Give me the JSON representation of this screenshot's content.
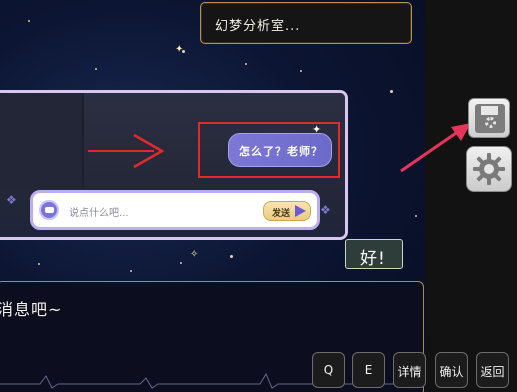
{
  "top_message": {
    "text": "幻梦分析室..."
  },
  "phone": {
    "chat_bubble_text": "怎么了？老师？",
    "input_placeholder": "说点什么吧...",
    "send_label": "发送"
  },
  "reply_bubble": {
    "text": "好!"
  },
  "dialogue": {
    "text": "消息吧~"
  },
  "side_buttons": {
    "save_icon": "floppy-disk-icon",
    "settings_icon": "gear-icon"
  },
  "bottom_buttons": [
    {
      "label": "Q"
    },
    {
      "label": "E"
    },
    {
      "label": "详情"
    },
    {
      "label": "确认"
    },
    {
      "label": "返回"
    }
  ],
  "colors": {
    "highlight_red": "#e12a2a",
    "pointer_pink": "#e8345a",
    "bubble_purple": "#7d77d6"
  }
}
